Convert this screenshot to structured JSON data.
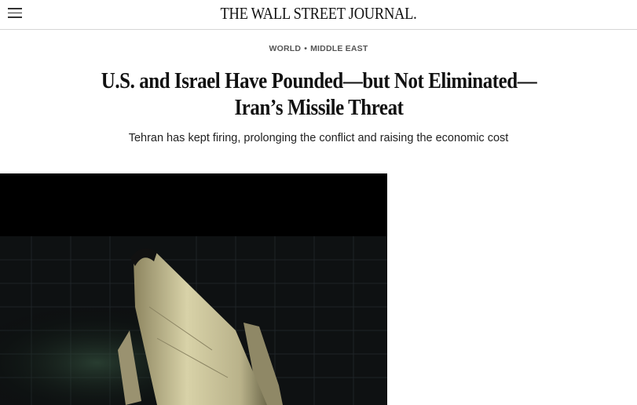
{
  "header": {
    "masthead": "THE WALL STREET JOURNAL."
  },
  "article": {
    "section": "WORLD",
    "subsection": "MIDDLE EAST",
    "headline": "U.S. and Israel Have Pounded—but Not Eliminated—Iran’s Missile Threat",
    "subheadline": "Tehran has kept firing, prolonging the conflict and raising the economic cost"
  },
  "icons": {
    "menu": "hamburger-menu-icon"
  },
  "colors": {
    "background": "#ffffff",
    "text": "#111111",
    "section": "#555555",
    "photo_bg": "#000000"
  }
}
